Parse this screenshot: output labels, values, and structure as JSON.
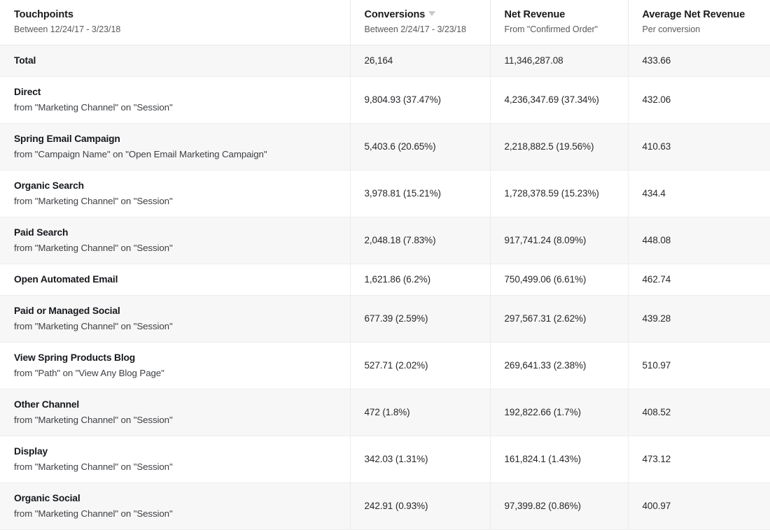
{
  "columns": [
    {
      "id": "touchpoints",
      "title": "Touchpoints",
      "subtitle": "Between 12/24/17 - 3/23/18",
      "sorted": false,
      "sort_icon": ""
    },
    {
      "id": "conversions",
      "title": "Conversions",
      "subtitle": "Between 2/24/17 - 3/23/18",
      "sorted": true,
      "sort_icon": "caret-down-icon"
    },
    {
      "id": "net_revenue",
      "title": "Net Revenue",
      "subtitle": "From \"Confirmed Order\"",
      "sorted": false,
      "sort_icon": ""
    },
    {
      "id": "avg_net_revenue",
      "title": "Average Net Revenue",
      "subtitle": "Per conversion",
      "sorted": false,
      "sort_icon": ""
    }
  ],
  "total_row": {
    "label": "Total",
    "source": "",
    "conversions": "26,164",
    "net_revenue": "11,346,287.08",
    "avg_net_revenue": "433.66"
  },
  "rows": [
    {
      "label": "Direct",
      "source": "from \"Marketing Channel\" on \"Session\"",
      "conversions": "9,804.93 (37.47%)",
      "net_revenue": "4,236,347.69 (37.34%)",
      "avg_net_revenue": "432.06"
    },
    {
      "label": "Spring Email Campaign",
      "source": "from \"Campaign Name\" on \"Open Email Marketing Campaign\"",
      "conversions": "5,403.6 (20.65%)",
      "net_revenue": "2,218,882.5 (19.56%)",
      "avg_net_revenue": "410.63"
    },
    {
      "label": "Organic Search",
      "source": "from \"Marketing Channel\" on \"Session\"",
      "conversions": "3,978.81 (15.21%)",
      "net_revenue": "1,728,378.59 (15.23%)",
      "avg_net_revenue": "434.4"
    },
    {
      "label": "Paid Search",
      "source": "from \"Marketing Channel\" on \"Session\"",
      "conversions": "2,048.18 (7.83%)",
      "net_revenue": "917,741.24 (8.09%)",
      "avg_net_revenue": "448.08"
    },
    {
      "label": "Open Automated Email",
      "source": "",
      "conversions": "1,621.86 (6.2%)",
      "net_revenue": "750,499.06 (6.61%)",
      "avg_net_revenue": "462.74"
    },
    {
      "label": "Paid or Managed Social",
      "source": "from \"Marketing Channel\" on \"Session\"",
      "conversions": "677.39 (2.59%)",
      "net_revenue": "297,567.31 (2.62%)",
      "avg_net_revenue": "439.28"
    },
    {
      "label": "View Spring Products Blog",
      "source": "from \"Path\" on \"View Any Blog Page\"",
      "conversions": "527.71 (2.02%)",
      "net_revenue": "269,641.33 (2.38%)",
      "avg_net_revenue": "510.97"
    },
    {
      "label": "Other Channel",
      "source": "from \"Marketing Channel\" on \"Session\"",
      "conversions": "472 (1.8%)",
      "net_revenue": "192,822.66 (1.7%)",
      "avg_net_revenue": "408.52"
    },
    {
      "label": "Display",
      "source": "from \"Marketing Channel\" on \"Session\"",
      "conversions": "342.03 (1.31%)",
      "net_revenue": "161,824.1 (1.43%)",
      "avg_net_revenue": "473.12"
    },
    {
      "label": "Organic Social",
      "source": "from \"Marketing Channel\" on \"Session\"",
      "conversions": "242.91 (0.93%)",
      "net_revenue": "97,399.82 (0.86%)",
      "avg_net_revenue": "400.97"
    }
  ],
  "colors": {
    "row_shaded": "#f7f7f7",
    "row_plain": "#ffffff",
    "border": "#ededed",
    "text_primary": "#16181c",
    "text_secondary": "#5a5a5a",
    "sort_caret": "#c8c8c8"
  }
}
